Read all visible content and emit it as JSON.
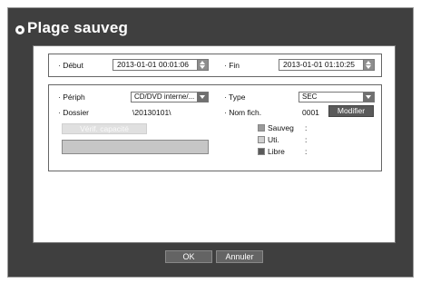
{
  "title": "Plage sauveg",
  "range": {
    "start_label": "· Début",
    "start_value": "2013-01-01 00:01:06",
    "end_label": "· Fin",
    "end_value": "2013-01-01 01:10:25"
  },
  "details": {
    "device_label": "· Périph",
    "device_value": "CD/DVD interne/...",
    "type_label": "· Type",
    "type_value": "SEC",
    "folder_label": "· Dossier",
    "folder_value": "\\20130101\\",
    "filename_label": "· Nom fich.",
    "filename_value": "0001",
    "modify_label": "Modifier",
    "check_capacity_label": "Vérif. capacité"
  },
  "legend": [
    {
      "label": "Sauveg",
      "sep": ":",
      "color": "#9a9a9a"
    },
    {
      "label": "Uti.",
      "sep": ":",
      "color": "#d0d0d0"
    },
    {
      "label": "Libre",
      "sep": ":",
      "color": "#5a5a5a"
    }
  ],
  "footer": {
    "ok_label": "OK",
    "cancel_label": "Annuler"
  },
  "colors": {
    "window_bg": "#3f3f3f",
    "content_bg": "#ffffff",
    "button_bg": "#646464"
  }
}
